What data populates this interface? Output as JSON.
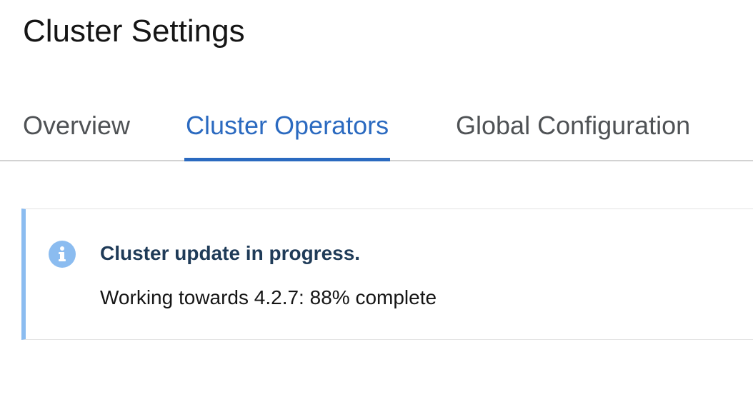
{
  "page": {
    "title": "Cluster Settings"
  },
  "tabs": [
    {
      "label": "Overview",
      "active": false
    },
    {
      "label": "Cluster Operators",
      "active": true
    },
    {
      "label": "Global Configuration",
      "active": false
    }
  ],
  "alert": {
    "icon": "info-icon",
    "title": "Cluster update in progress.",
    "message": "Working towards 4.2.7: 88% complete",
    "colors": {
      "accent": "#8bbcf0",
      "title": "#1f3b58"
    }
  },
  "colors": {
    "active_tab": "#2b6ac0",
    "inactive_tab": "#4f5255"
  }
}
